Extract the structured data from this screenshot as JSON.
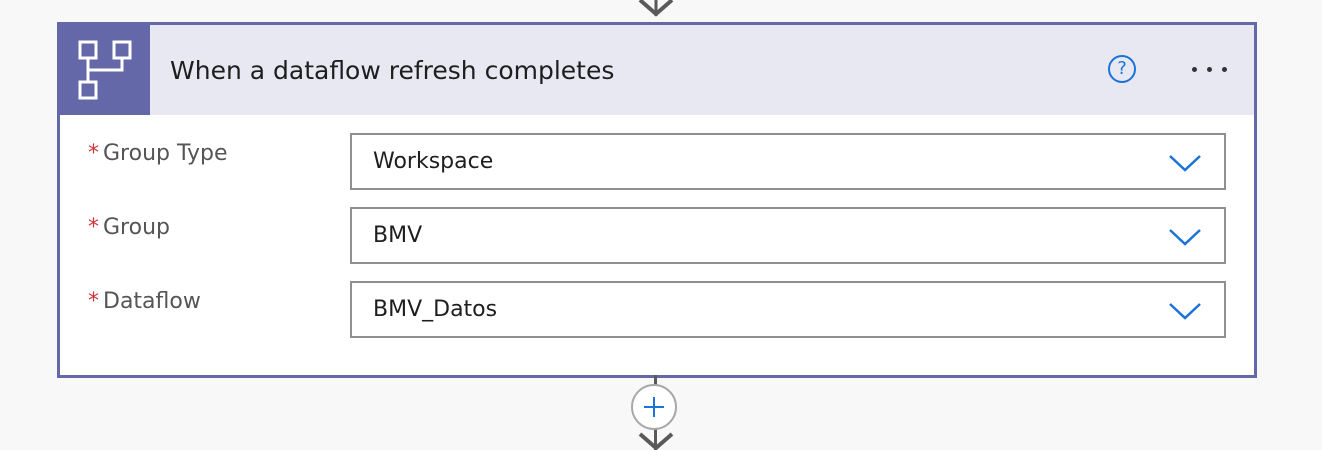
{
  "flow": {
    "trigger_card": {
      "title": "When a dataflow refresh completes",
      "icon": "dataflow-icon",
      "help_icon": "question-icon",
      "more_icon": "ellipsis-icon",
      "header_bg": "#e8e8f2",
      "accent_color": "#6468a8",
      "fields": [
        {
          "label": "Group Type",
          "required": true,
          "required_mark": "*",
          "value": "Workspace"
        },
        {
          "label": "Group",
          "required": true,
          "required_mark": "*",
          "value": "BMV"
        },
        {
          "label": "Dataflow",
          "required": true,
          "required_mark": "*",
          "value": "BMV_Datos"
        }
      ]
    },
    "add_step_icon": "plus-icon",
    "link_color": "#1a73d9",
    "required_color": "#d13438"
  }
}
